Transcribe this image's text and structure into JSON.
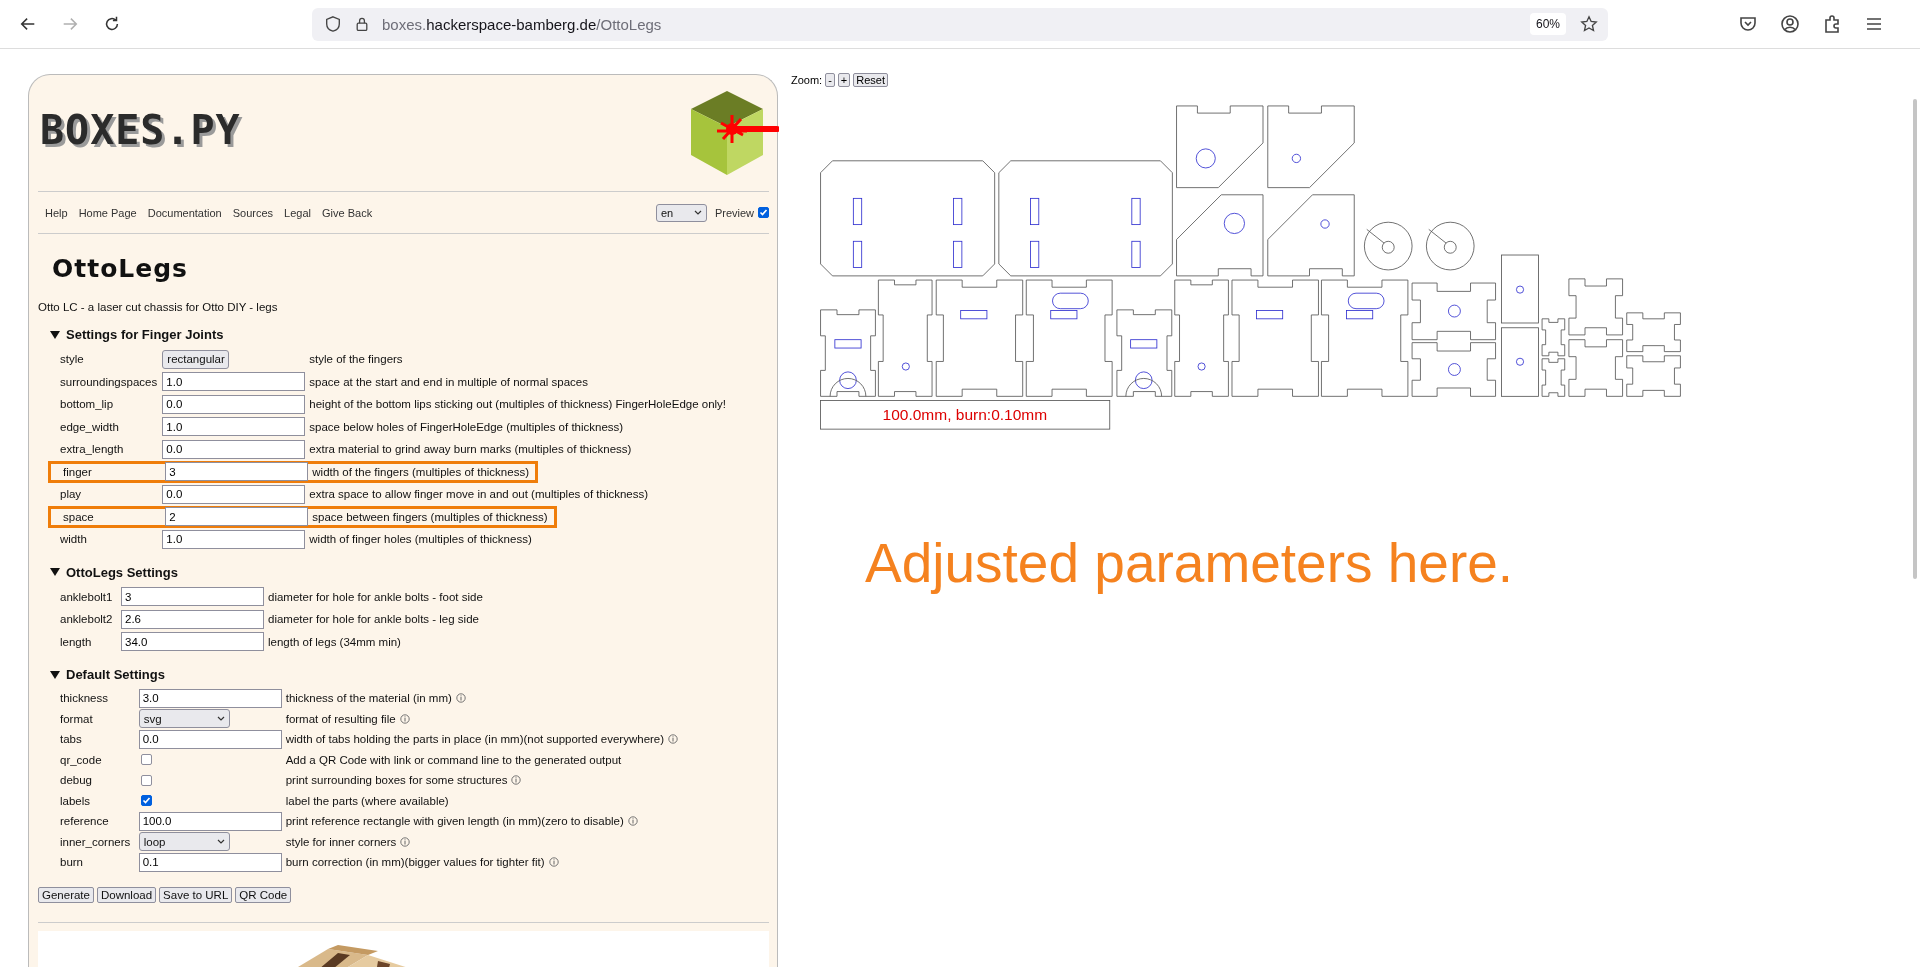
{
  "browser": {
    "url_prefix": "boxes.",
    "url_host": "hackerspace-bamberg.de",
    "url_path": "/OttoLegs",
    "zoom": "60%",
    "forward_disabled": true
  },
  "header": {
    "logo_text": "BOXES.PY"
  },
  "nav": {
    "links": [
      "Help",
      "Home Page",
      "Documentation",
      "Sources",
      "Legal",
      "Give Back"
    ],
    "language": "en",
    "preview_label": "Preview",
    "preview_checked": true
  },
  "generator": {
    "title": "OttoLegs",
    "description": "Otto LC - a laser cut chassis for Otto DIY - legs"
  },
  "groups": [
    {
      "title": "Settings for Finger Joints",
      "expanded": true,
      "rows": [
        {
          "label": "style",
          "kind": "select",
          "value": "rectangular",
          "description": "style of the fingers",
          "info": false,
          "highlighted": false
        },
        {
          "label": "surroundingspaces",
          "kind": "input",
          "value": "1.0",
          "description": "space at the start and end in multiple of normal spaces",
          "info": false,
          "highlighted": false
        },
        {
          "label": "bottom_lip",
          "kind": "input",
          "value": "0.0",
          "description": "height of the bottom lips sticking out (multiples of thickness) FingerHoleEdge only!",
          "info": false,
          "highlighted": false
        },
        {
          "label": "edge_width",
          "kind": "input",
          "value": "1.0",
          "description": "space below holes of FingerHoleEdge (multiples of thickness)",
          "info": false,
          "highlighted": false
        },
        {
          "label": "extra_length",
          "kind": "input",
          "value": "0.0",
          "description": "extra material to grind away burn marks (multiples of thickness)",
          "info": false,
          "highlighted": false
        },
        {
          "label": "finger",
          "kind": "input",
          "value": "3",
          "description": "width of the fingers (multiples of thickness)",
          "info": false,
          "highlighted": true
        },
        {
          "label": "play",
          "kind": "input",
          "value": "0.0",
          "description": "extra space to allow finger move in and out (multiples of thickness)",
          "info": false,
          "highlighted": false
        },
        {
          "label": "space",
          "kind": "input",
          "value": "2",
          "description": "space between fingers (multiples of thickness)",
          "info": false,
          "highlighted": true
        },
        {
          "label": "width",
          "kind": "input",
          "value": "1.0",
          "description": "width of finger holes (multiples of thickness)",
          "info": false,
          "highlighted": false
        }
      ]
    },
    {
      "title": "OttoLegs Settings",
      "expanded": true,
      "rows": [
        {
          "label": "anklebolt1",
          "kind": "input",
          "value": "3",
          "description": "diameter for hole for ankle bolts - foot side",
          "info": false,
          "highlighted": false
        },
        {
          "label": "anklebolt2",
          "kind": "input",
          "value": "2.6",
          "description": "diameter for hole for ankle bolts - leg side",
          "info": false,
          "highlighted": false
        },
        {
          "label": "length",
          "kind": "input",
          "value": "34.0",
          "description": "length of legs (34mm min)",
          "info": false,
          "highlighted": false
        }
      ]
    },
    {
      "title": "Default Settings",
      "expanded": true,
      "rows": [
        {
          "label": "thickness",
          "kind": "input",
          "value": "3.0",
          "description": "thickness of the material (in mm)",
          "info": true,
          "highlighted": false
        },
        {
          "label": "format",
          "kind": "select",
          "value": "svg",
          "description": "format of resulting file",
          "info": true,
          "highlighted": false
        },
        {
          "label": "tabs",
          "kind": "input",
          "value": "0.0",
          "description": "width of tabs holding the parts in place (in mm)(not supported everywhere)",
          "info": true,
          "highlighted": false
        },
        {
          "label": "qr_code",
          "kind": "checkbox",
          "checked": false,
          "description": "Add a QR Code with link or command line to the generated output",
          "info": false,
          "highlighted": false
        },
        {
          "label": "debug",
          "kind": "checkbox",
          "checked": false,
          "description": "print surrounding boxes for some structures",
          "info": true,
          "highlighted": false
        },
        {
          "label": "labels",
          "kind": "checkbox",
          "checked": true,
          "description": "label the parts (where available)",
          "info": false,
          "highlighted": false
        },
        {
          "label": "reference",
          "kind": "input",
          "value": "100.0",
          "description": "print reference rectangle with given length (in mm)(zero to disable)",
          "info": true,
          "highlighted": false
        },
        {
          "label": "inner_corners",
          "kind": "select",
          "value": "loop",
          "description": "style for inner corners",
          "info": true,
          "highlighted": false
        },
        {
          "label": "burn",
          "kind": "input",
          "value": "0.1",
          "description": "burn correction (in mm)(bigger values for tighter fit)",
          "info": true,
          "highlighted": false
        }
      ]
    }
  ],
  "buttons": [
    "Generate",
    "Download",
    "Save to URL",
    "QR Code"
  ],
  "canvas": {
    "zoom_label": "Zoom:",
    "zoom_buttons": [
      "-",
      "+",
      "Reset"
    ],
    "reference_label": "100.0mm, burn:0.10mm"
  },
  "annotation": "Adjusted parameters here."
}
